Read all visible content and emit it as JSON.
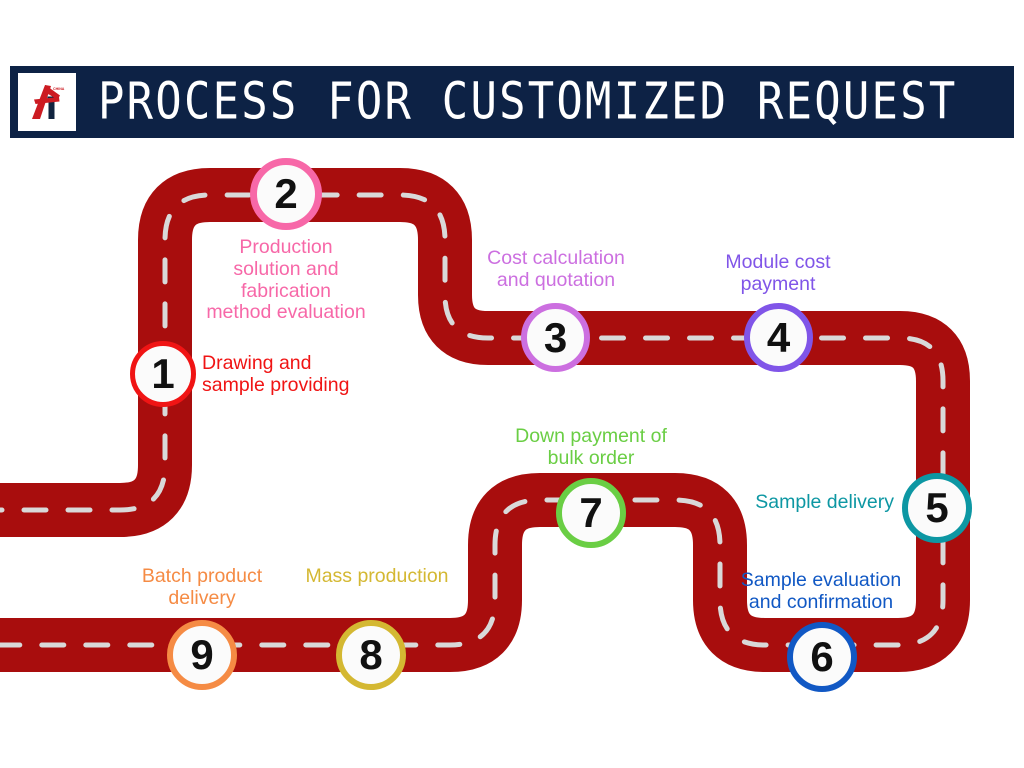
{
  "header": {
    "title": "PROCESS FOR CUSTOMIZED REQUEST",
    "logo_alt": "a-star-china-logo",
    "logo_sub_text": "CHINA",
    "bar_color": "#0d2245",
    "logo_mark_color": "#cc1b22",
    "logo_accent_color": "#11243f"
  },
  "road": {
    "surface_color": "#a80d0d",
    "dash_color": "#d9d9d9",
    "background": "#ffffff"
  },
  "steps": [
    {
      "number": "1",
      "label": "Drawing and\nsample providing",
      "color": "#f01414",
      "align": "right"
    },
    {
      "number": "2",
      "label": "Production\nsolution and\nfabrication\nmethod evaluation",
      "color": "#f768a8",
      "align": "center"
    },
    {
      "number": "3",
      "label": "Cost calculation\nand quotation",
      "color": "#cc6fe0",
      "align": "center"
    },
    {
      "number": "4",
      "label": "Module cost\npayment",
      "color": "#8055e8",
      "align": "center"
    },
    {
      "number": "5",
      "label": "Sample delivery",
      "color": "#0d97a3",
      "align": "left"
    },
    {
      "number": "6",
      "label": "Sample evaluation\nand confirmation",
      "color": "#1158c4",
      "align": "center"
    },
    {
      "number": "7",
      "label": "Down payment of\nbulk order",
      "color": "#6ace44",
      "align": "center"
    },
    {
      "number": "8",
      "label": "Mass production",
      "color": "#d4b832",
      "align": "center"
    },
    {
      "number": "9",
      "label": "Batch product\ndelivery",
      "color": "#f58b44",
      "align": "center"
    }
  ]
}
